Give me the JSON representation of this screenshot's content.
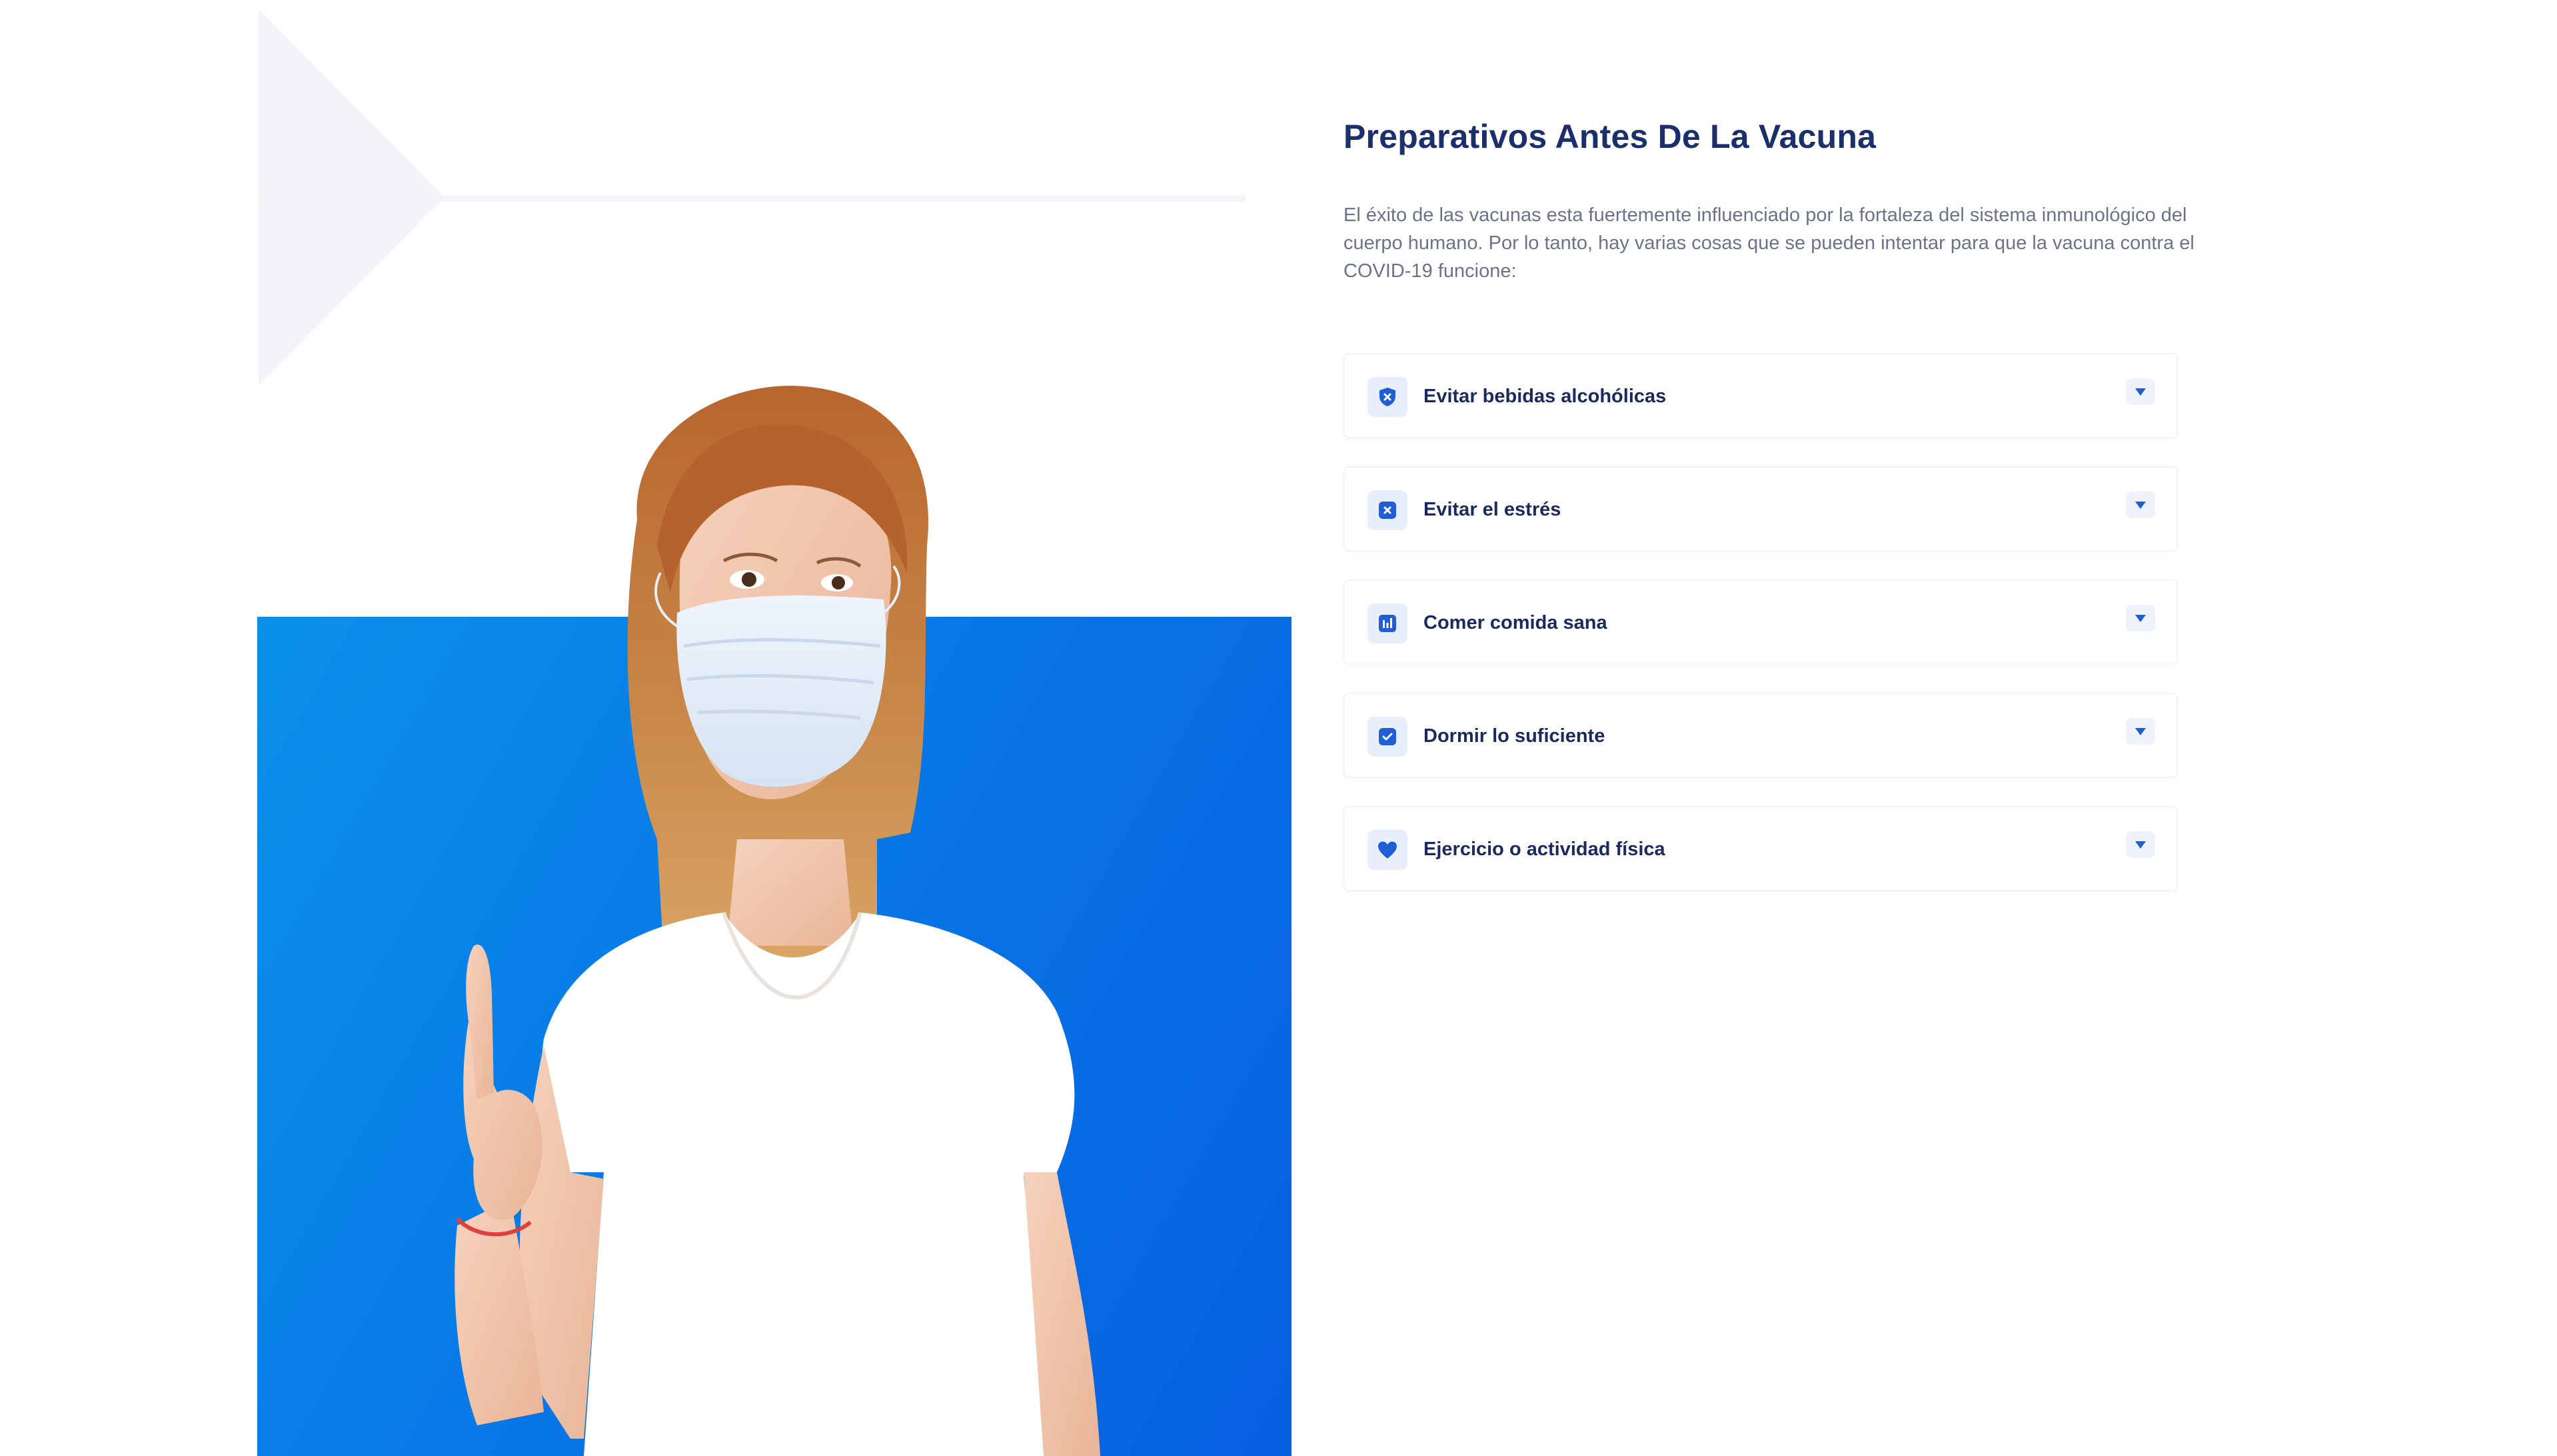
{
  "section": {
    "title": "Preparativos Antes De La Vacuna",
    "intro": "El éxito de las vacunas esta fuertemente influenciado por la fortaleza del sistema inmunológico del cuerpo humano. Por lo tanto, hay varias cosas que se pueden intentar para que la vacuna contra el COVID-19 funcione:"
  },
  "colors": {
    "title": "#1a2f6b",
    "text": "#6b7388",
    "accent": "#1f5fd6",
    "panel_blue": "#0873e6"
  },
  "accordion": {
    "items": [
      {
        "label": "Evitar bebidas alcohólicas",
        "icon": "shield-x-icon"
      },
      {
        "label": "Evitar el estrés",
        "icon": "x-square-icon"
      },
      {
        "label": "Comer comida sana",
        "icon": "bar-chart-icon"
      },
      {
        "label": "Dormir lo suficiente",
        "icon": "check-square-icon"
      },
      {
        "label": "Ejercicio o actividad física",
        "icon": "heart-icon"
      }
    ],
    "toggle_icon": "caret-down-icon"
  },
  "hero": {
    "image": "woman-wearing-face-mask-raising-finger"
  }
}
